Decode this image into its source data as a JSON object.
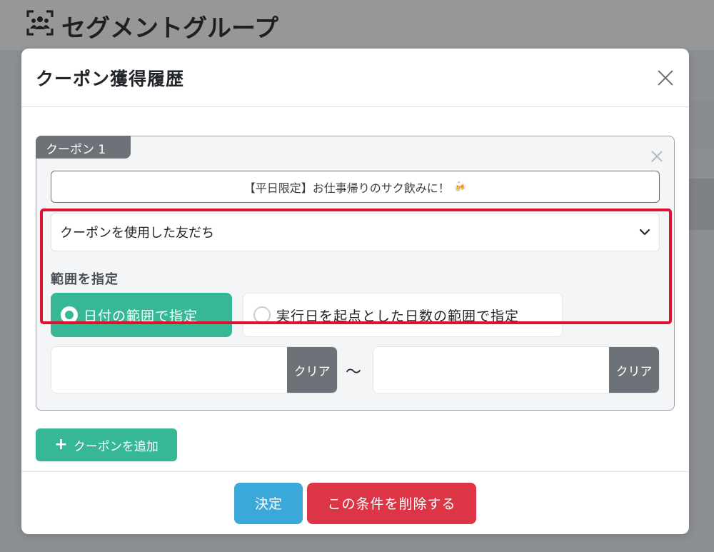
{
  "page": {
    "title": "セグメントグループ"
  },
  "modal": {
    "title": "クーポン獲得履歴",
    "coupon_card": {
      "tab_label": "クーポン 1",
      "coupon_name": "【平日限定】お仕事帰りのサク飲みに！",
      "coupon_name_icon": "🍻",
      "condition_select": "クーポンを使用した友だち",
      "range_label": "範囲を指定",
      "range_options": [
        {
          "label": "日付の範囲で指定",
          "selected": true
        },
        {
          "label": "実行日を起点とした日数の範囲で指定",
          "selected": false
        }
      ],
      "date_from": {
        "value": "",
        "clear_label": "クリア"
      },
      "date_separator": "〜",
      "date_to": {
        "value": "",
        "clear_label": "クリア"
      }
    },
    "add_coupon_label": "クーポンを追加",
    "footer": {
      "ok_label": "決定",
      "delete_label": "この条件を削除する"
    }
  },
  "colors": {
    "accent_green": "#36b896",
    "primary_blue": "#3aa8d8",
    "danger_red": "#dc3545",
    "highlight_red": "#e0112f",
    "secondary_gray": "#6c7278"
  }
}
